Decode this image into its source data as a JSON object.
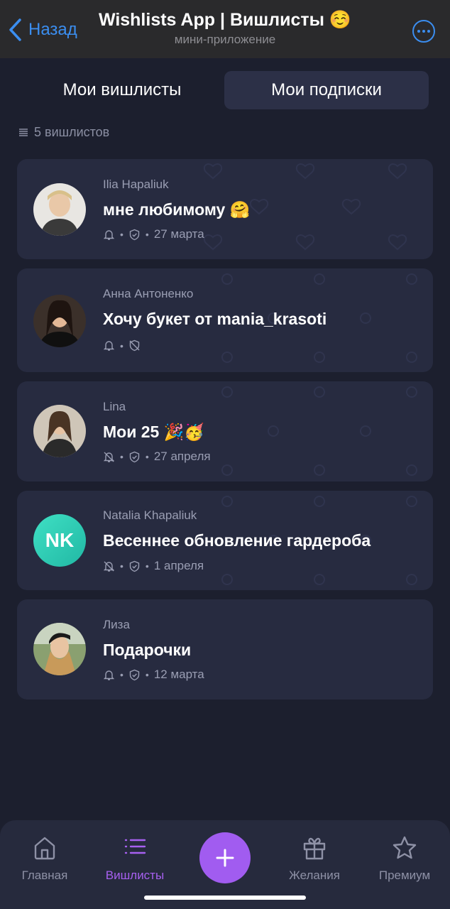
{
  "header": {
    "back_label": "Назад",
    "title": "Wishlists App | Вишлисты ☺️",
    "subtitle": "мини-приложение"
  },
  "tabs": [
    {
      "label": "Мои вишлисты",
      "active": false
    },
    {
      "label": "Мои подписки",
      "active": true
    }
  ],
  "wishlist_count": "5 вишлистов",
  "wishlists": [
    {
      "owner": "Ilia Hapaliuk",
      "title": "мне любимому 🤗",
      "date": "27 марта",
      "notifications": "on",
      "privacy": "shield"
    },
    {
      "owner": "Анна Антоненко",
      "title": "Хочу букет от mania_krasoti",
      "date": "",
      "notifications": "on",
      "privacy": "shield-off"
    },
    {
      "owner": "Lina",
      "title": "Мои 25 🎉🥳",
      "date": "27 апреля",
      "notifications": "off",
      "privacy": "shield"
    },
    {
      "owner": "Natalia Khapaliuk",
      "title": "Весеннее обновление гардероба",
      "date": "1 апреля",
      "notifications": "off",
      "privacy": "shield",
      "initials": "NK"
    },
    {
      "owner": "Лиза",
      "title": "Подарочки",
      "date": "12 марта",
      "notifications": "on",
      "privacy": "shield"
    }
  ],
  "bottom_nav": {
    "home": "Главная",
    "wishlists": "Вишлисты",
    "wishes": "Желания",
    "premium": "Премиум"
  },
  "colors": {
    "background": "#1c1f2e",
    "card": "#272b40",
    "accent": "#a15cf0",
    "link": "#3b8ef0"
  }
}
